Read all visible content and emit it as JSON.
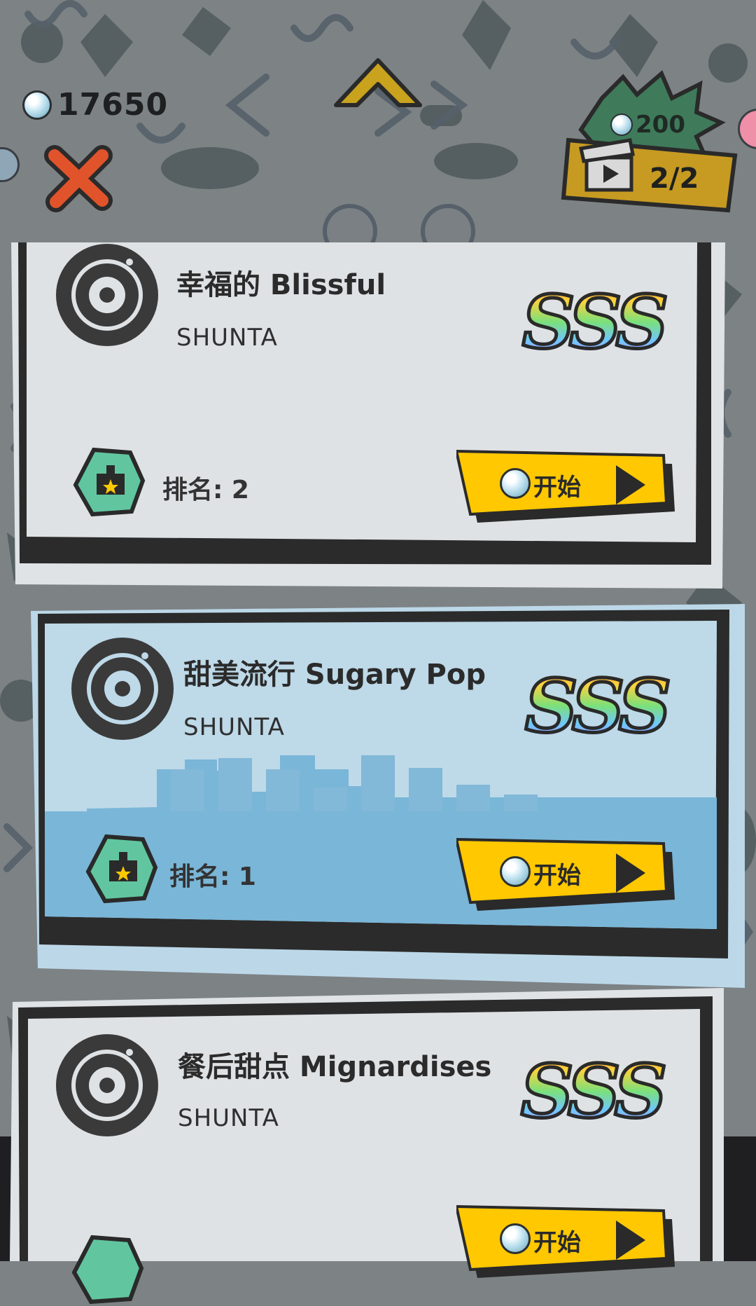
{
  "hud": {
    "currency_value": "17650",
    "video_cost": "200",
    "video_count": "2/2"
  },
  "songs": [
    {
      "title": "幸福的 Blissful",
      "artist": "SHUNTA",
      "grade": "SSS",
      "rank_label": "排名: 2",
      "start_label": "开始"
    },
    {
      "title": "甜美流行 Sugary Pop",
      "artist": "SHUNTA",
      "grade": "SSS",
      "rank_label": "排名: 1",
      "start_label": "开始"
    },
    {
      "title": "餐后甜点 Mignardises",
      "artist": "SHUNTA",
      "grade": "SSS",
      "rank_label": "",
      "start_label": "开始"
    }
  ],
  "icons": {
    "currency": "pearl-icon",
    "close": "close-x-icon",
    "scroll_up": "chevron-up-icon",
    "video": "clapperboard-icon",
    "disc": "vinyl-disc-icon",
    "rank": "crown-star-badge-icon",
    "play": "play-triangle-icon"
  },
  "colors": {
    "background": "#7d8285",
    "card": "#e1e4e7",
    "card_selected": "#bed9e8",
    "start_button": "#ffc800",
    "badge": "#61c6a0",
    "close": "#e0532b"
  }
}
